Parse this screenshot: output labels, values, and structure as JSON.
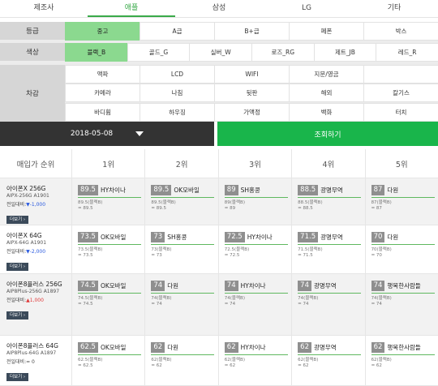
{
  "manufacturer_tabs": [
    "제조사",
    "애플",
    "삼성",
    "LG",
    "기타"
  ],
  "filters": {
    "grade": {
      "label": "등급",
      "options": [
        "중고",
        "A급",
        "B+급",
        "페폰",
        "박스"
      ]
    },
    "color": {
      "label": "색상",
      "options": [
        "블랙_B",
        "골드_G",
        "실버_W",
        "로즈_RG",
        "제트_JB",
        "레드_R"
      ]
    },
    "deduction": {
      "label": "차감",
      "options": [
        "액파",
        "LCD",
        "WIFI",
        "지문/영금",
        "",
        "카메라",
        "나침",
        "뒷판",
        "해외",
        "칼기스",
        "바디휨",
        "하우징",
        "가액정",
        "백화",
        "터치"
      ]
    }
  },
  "date_picker": {
    "value": "2018-05-08"
  },
  "search_button": {
    "label": "조회하기"
  },
  "rank_header": {
    "title": "매입가 순위",
    "ranks": [
      "1위",
      "2위",
      "3위",
      "4위",
      "5위"
    ]
  },
  "detail_label": "더보기 ›",
  "change_label": "전일대비:",
  "products": [
    {
      "name": "아이폰X 256G",
      "model": "AIPX-256G A1901",
      "change": "▼-1,000",
      "trend": "dn",
      "offers": [
        {
          "price": "89.5",
          "shop": "HY차이나",
          "sub1": "89.5(블랙B)",
          "sub2": "= 89.5"
        },
        {
          "price": "89.5",
          "shop": "OK모바일",
          "sub1": "89.5(블랙B)",
          "sub2": "= 89.5"
        },
        {
          "price": "89",
          "shop": "SH홍콩",
          "sub1": "89(블랙B)",
          "sub2": "= 89"
        },
        {
          "price": "88.5",
          "shop": "광명무역",
          "sub1": "88.5(블랙B)",
          "sub2": "= 88.5"
        },
        {
          "price": "87",
          "shop": "다원",
          "sub1": "87(블랙B)",
          "sub2": "= 87"
        }
      ]
    },
    {
      "name": "아이폰X 64G",
      "model": "AIPX-64G A1901",
      "change": "▼-2,000",
      "trend": "dn",
      "offers": [
        {
          "price": "73.5",
          "shop": "OK모바일",
          "sub1": "73.5(블랙B)",
          "sub2": "= 73.5"
        },
        {
          "price": "73",
          "shop": "SH홍콩",
          "sub1": "73(블랙B)",
          "sub2": "= 73"
        },
        {
          "price": "72.5",
          "shop": "HY차이나",
          "sub1": "72.5(블랙B)",
          "sub2": "= 72.5"
        },
        {
          "price": "71.5",
          "shop": "광명무역",
          "sub1": "71.5(블랙B)",
          "sub2": "= 71.5"
        },
        {
          "price": "70",
          "shop": "다원",
          "sub1": "70(블랙B)",
          "sub2": "= 70"
        }
      ]
    },
    {
      "name": "아이폰8플러스 256G",
      "model": "AIP8Plus-256G A1897",
      "change": "▲1,000",
      "trend": "up",
      "offers": [
        {
          "price": "74.5",
          "shop": "OK모바일",
          "sub1": "74.5(블랙B)",
          "sub2": "= 74.5"
        },
        {
          "price": "74",
          "shop": "다원",
          "sub1": "74(블랙B)",
          "sub2": "= 74"
        },
        {
          "price": "74",
          "shop": "HY차이나",
          "sub1": "74(블랙B)",
          "sub2": "= 74"
        },
        {
          "price": "74",
          "shop": "광명무역",
          "sub1": "74(블랙B)",
          "sub2": "= 74"
        },
        {
          "price": "74",
          "shop": "행복한사람들",
          "sub1": "74(블랙B)",
          "sub2": "= 74"
        }
      ]
    },
    {
      "name": "아이폰8플러스 64G",
      "model": "AIP8Plus-64G A1897",
      "change": "= 0",
      "trend": "eq",
      "offers": [
        {
          "price": "62.5",
          "shop": "OK모바일",
          "sub1": "62.5(블랙B)",
          "sub2": "= 62.5"
        },
        {
          "price": "62",
          "shop": "다원",
          "sub1": "62(블랙B)",
          "sub2": "= 62"
        },
        {
          "price": "62",
          "shop": "HY차이나",
          "sub1": "62(블랙B)",
          "sub2": "= 62"
        },
        {
          "price": "62",
          "shop": "광명무역",
          "sub1": "62(블랙B)",
          "sub2": "= 62"
        },
        {
          "price": "62",
          "shop": "행복한사람들",
          "sub1": "62(블랙B)",
          "sub2": "= 62"
        }
      ]
    }
  ],
  "colors": {
    "accent": "#19b54b",
    "selected": "#8bd98f",
    "dark": "#333333",
    "down": "#2a5adf",
    "up": "#e03a3a"
  }
}
